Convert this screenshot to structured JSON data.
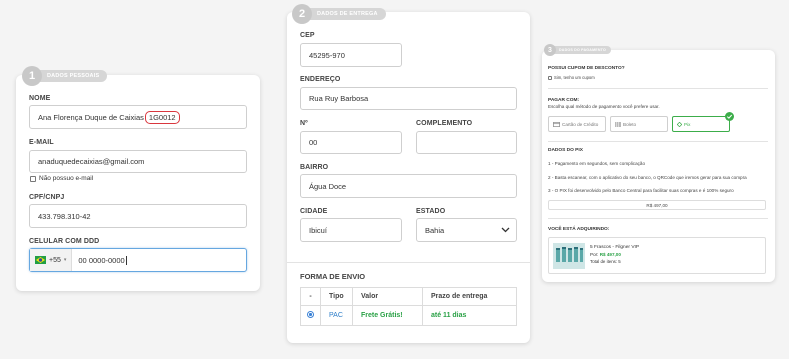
{
  "personal": {
    "step_number": "1",
    "step_title": "DADOS PESSOAIS",
    "nome_label": "NOME",
    "nome_value": "Ana Florença Duque de Caixias",
    "nome_highlight": "1G0012",
    "email_label": "E-MAIL",
    "email_value": "anaduquedecaixias@gmail.com",
    "no_email_label": "Não possuo e-mail",
    "cpf_label": "CPF/CNPJ",
    "cpf_value": "433.798.310-42",
    "phone_label": "CELULAR COM DDD",
    "phone_code": "+55",
    "phone_value": "00 0000-0000",
    "flag_icon": "brazil-flag-icon"
  },
  "delivery": {
    "step_number": "2",
    "step_title": "DADOS DE ENTREGA",
    "cep_label": "CEP",
    "cep_value": "45295-970",
    "endereco_label": "ENDEREÇO",
    "endereco_value": "Rua Ruy Barbosa",
    "numero_label": "Nº",
    "numero_value": "00",
    "complemento_label": "COMPLEMENTO",
    "complemento_value": "",
    "bairro_label": "BAIRRO",
    "bairro_value": "Água Doce",
    "cidade_label": "CIDADE",
    "cidade_value": "Ibicuí",
    "estado_label": "ESTADO",
    "estado_value": "Bahia",
    "shipping_title": "FORMA DE ENVIO",
    "shipping_headers": [
      "-",
      "Tipo",
      "Valor",
      "Prazo de entrega"
    ],
    "shipping_row": {
      "type": "PAC",
      "value": "Frete Grátis!",
      "deadline": "até 11 dias"
    }
  },
  "payment": {
    "step_number": "3",
    "step_title": "DADOS DO PAGAMENTO",
    "coupon_question": "POSSUI CUPOM DE DESCONTO?",
    "coupon_option": "Sim, tenho um cupom",
    "pay_with": "PAGAR COM:",
    "pay_instruction": "Escolha qual método de pagamento você prefere usar.",
    "methods": [
      "Cartão de Crédito",
      "Boleto",
      "Pix"
    ],
    "pix_title": "DADOS DO PIX",
    "pix_steps": [
      "1 - Pagamento em segundos, sem complicação",
      "2 - Basta escanear, com o aplicativo do seu banco, o QRCode que iremos gerar para sua compra",
      "3 - O PIX foi desenvolvido pelo Banco Central para facilitar suas compras e é 100% seguro"
    ],
    "pix_total": "R$ 497,00",
    "buying_title": "VOCÊ ESTÁ ADQUIRINDO:",
    "product_name": "5 Frascos - Filgner VIP",
    "product_price_prefix": "Por:",
    "product_price": "R$ 497,00",
    "product_qty": "Total de itens: 5"
  },
  "colors": {
    "accent_green": "#2aa146",
    "highlight_red": "#d9373e",
    "focus_blue": "#66a7e0"
  }
}
